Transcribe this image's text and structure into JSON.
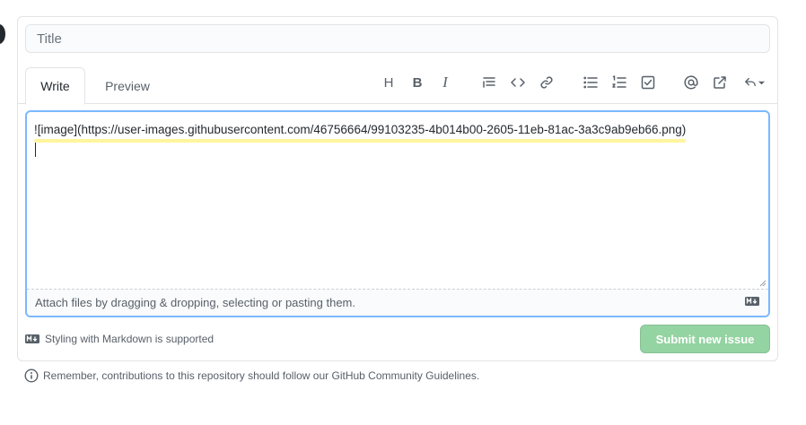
{
  "title_field": {
    "placeholder": "Title",
    "value": ""
  },
  "tabs": [
    {
      "label": "Write",
      "active": true
    },
    {
      "label": "Preview",
      "active": false
    }
  ],
  "toolbar": {
    "heading_label": "H",
    "bold_label": "B",
    "italic_label": "I",
    "icons": [
      "heading-icon",
      "bold-icon",
      "italic-icon",
      "quote-icon",
      "code-icon",
      "link-icon",
      "bulleted-list-icon",
      "numbered-list-icon",
      "task-list-icon",
      "mention-icon",
      "reference-icon",
      "reply-icon"
    ]
  },
  "editor": {
    "content": "![image](https://user-images.githubusercontent.com/46756664/99103235-4b014b00-2605-11eb-81ac-3a3c9ab9eb66.png)",
    "attach_hint": "Attach files by dragging & dropping, selecting or pasting them."
  },
  "footer": {
    "markdown_note": "Styling with Markdown is supported",
    "submit_label": "Submit new issue"
  },
  "guidelines_text": "Remember, contributions to this repository should follow our GitHub Community Guidelines.",
  "colors": {
    "submit_bg": "#94d3a2",
    "focus_border": "#79b8ff",
    "highlight": "#fff59d"
  }
}
